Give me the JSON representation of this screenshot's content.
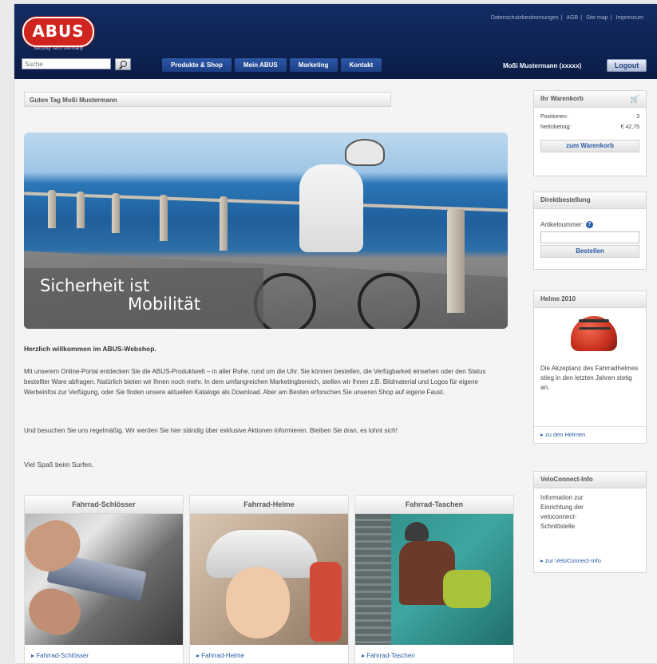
{
  "header": {
    "logo_text": "ABUS",
    "logo_sub": "Security Tech Germany",
    "top_links": [
      "Datenschutzbestimmungen",
      "AGB",
      "Site map",
      "Impressum"
    ],
    "search_placeholder": "Suche",
    "nav": [
      "Produkte & Shop",
      "Mein ABUS",
      "Marketing",
      "Kontakt"
    ],
    "user": "Moßi Mustermann (xxxxx)",
    "logout": "Logout"
  },
  "greeting": "Guten Tag Moßi Mustermann",
  "hero": {
    "line1": "Sicherheit ist",
    "line2": "Mobilität"
  },
  "content": {
    "welcome": "Herzlich willkommen im ABUS-Webshop.",
    "para1": "Mit unserem Online-Portal entdecken Sie die ABUS-Produktwelt – in aller Ruhe, rund um die Uhr. Sie können bestellen, die Verfügbarkeit einsehen oder den Status bestellter Ware abfragen. Natürlich bieten wir Ihnen noch mehr. In dem umfangreichen Marketingbereich, stellen wir Ihnen z.B. Bildmaterial und Logos für eigene Werbeinfos zur Verfügung, oder Sie finden unsere aktuellen Kataloge als Download. Aber am Besten erforschen Sie unseren Shop auf eigene Faust.",
    "para2": "Und besuchen Sie uns regelmäßig. Wir werden Sie hier ständig über exklusive Aktionen informieren. Bleiben Sie dran, es lohnt sich!",
    "surf": "Viel Spaß beim Surfen."
  },
  "products": [
    {
      "title": "Fahrrad-Schlösser",
      "link": "Fahrrad-Schlösser"
    },
    {
      "title": "Fahrrad-Helme",
      "link": "Fahrrad-Helme"
    },
    {
      "title": "Fahrrad-Taschen",
      "link": "Fahrrad-Taschen"
    }
  ],
  "cart": {
    "title": "Ihr Warenkorb",
    "positions_label": "Positionen:",
    "positions_value": "3",
    "net_label": "Nettobetrag:",
    "net_value": "€ 42,75",
    "button": "zum Warenkorb"
  },
  "direct": {
    "title": "Direktbestellung",
    "label": "Artikelnummer:",
    "help": "?",
    "button": "Bestellen"
  },
  "helmets": {
    "title": "Helme 2010",
    "text": "Die Akzeptanz des Fahrradhelmes stieg in den letzten Jahren stetig an.",
    "link": "zu den Helmen"
  },
  "velo": {
    "title": "VeloConnect-Info",
    "text": "Information zur Einrichtung der veloconnect-Schnittstelle",
    "link": "zur VeloConnect-Info"
  }
}
